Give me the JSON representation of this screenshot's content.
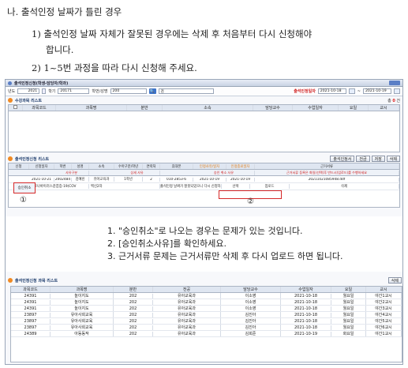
{
  "doc": {
    "title": "나. 출석인정 날짜가 틀린 경우",
    "step1a": "1) 출석인정 날짜 자체가 잘못된 경우에는 삭제 후 처음부터 다시 신청해야",
    "step1b": "합니다.",
    "step2": "2) 1~5번 과정을 따라 다시 신청해 주세요."
  },
  "window": {
    "title": "출석인정신청(학생-담당자/학과)",
    "close_label": "닫기"
  },
  "filter": {
    "year_label": "년도",
    "year": "2021",
    "term_label": "학기",
    "term": "20171",
    "student_label": "학번/성명",
    "student": "200",
    "search_label": "검",
    "date_label": "출석인정일자",
    "date_from": "2021-10-18",
    "date_to": "2021-10-19"
  },
  "course_section": {
    "title": "수강과목 리스트",
    "count_pre": "총",
    "count": "0",
    "count_post": "건",
    "columns": [
      "",
      "과목코드",
      "과목명",
      "분반",
      "소속",
      "담당교수",
      "수업일자",
      "요일",
      "교시"
    ]
  },
  "app_section": {
    "title": "출석인정신청 리스트",
    "buttons": [
      "출석인정서",
      "전금",
      "저장",
      "삭제"
    ],
    "header_row1": [
      "신청",
      "신청일자",
      "학번",
      "성명",
      "소속",
      "수아구분/학년",
      "연락처",
      "휴대폰",
      "인정사유/일자",
      "인정종료일자",
      "근거서류"
    ],
    "header_row2": [
      "",
      "",
      "사유구분",
      "",
      "",
      "상세 사유",
      "",
      "",
      "승인 취소 사유",
      "",
      "근거서류 등록은 화일(선택)후 반드시(업로드)를 수행하세요"
    ],
    "row1": [
      "",
      "2021-10-21",
      "2002484",
      "김예린",
      "유아교육과",
      "1학년",
      "2",
      "",
      "010-2853-6",
      "2021-10-19",
      "2021-10-19",
      "20211021085948.ddf"
    ],
    "approve_cancel": "승인취소",
    "row2_reason": "코로나바이러스감염증-19(COV",
    "row2_detail": "백신2차",
    "cancel_reason": "출석인정 날짜가 잘못되었으니 다시 신청하세요",
    "select_label": "선택",
    "upload_label": "업로드",
    "delete_label": "삭제",
    "circle1": "①",
    "circle2": "②"
  },
  "notes": [
    "1.  \"승인취소\"로 나오는 경우는 문제가 있는 것입니다.",
    "2.  [승인취소사유]를 확인하세요.",
    "3.  근거서류 문제는 근거서류만 삭제 후 다시 업로드 하면 됩니다."
  ],
  "subject_section": {
    "title": "출석인정신청 과목 리스트",
    "delete_label": "삭제",
    "columns": [
      "과목코드",
      "과목명",
      "분반",
      "전공",
      "담당교수",
      "수업일자",
      "요일",
      "교시"
    ],
    "rows": [
      [
        "24391",
        "놀이지도",
        "202",
        "유아교육과",
        "이소영",
        "2021-10-18",
        "월요일",
        "야간1교시"
      ],
      [
        "24391",
        "놀이지도",
        "202",
        "유아교육과",
        "이소영",
        "2021-10-18",
        "월요일",
        "야간2교시"
      ],
      [
        "24391",
        "놀이지도",
        "202",
        "유아교육과",
        "이소영",
        "2021-10-18",
        "월요일",
        "야간3교시"
      ],
      [
        "23897",
        "유아사회교육",
        "202",
        "유아교육과",
        "김진아",
        "2021-10-18",
        "월요일",
        "야간4교시"
      ],
      [
        "23897",
        "유아사회교육",
        "202",
        "유아교육과",
        "김진아",
        "2021-10-18",
        "월요일",
        "야간5교시"
      ],
      [
        "23897",
        "유아사회교육",
        "202",
        "유아교육과",
        "김진아",
        "2021-10-18",
        "월요일",
        "야간6교시"
      ],
      [
        "24389",
        "아동동작",
        "202",
        "유아교육과",
        "김희준",
        "2021-10-19",
        "화요일",
        "야간1교시"
      ]
    ]
  },
  "colors": {
    "accent": "#3d74c9",
    "highlight": "#d62828",
    "section_dot": "#f08a24"
  }
}
